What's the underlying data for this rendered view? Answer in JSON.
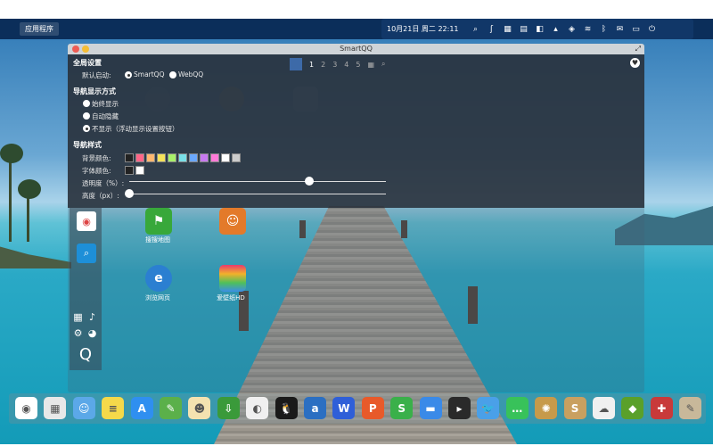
{
  "topbar": {
    "apps_button": "应用程序",
    "clock": "10月21日 周二 22:11",
    "tray_icons": [
      "search-icon",
      "python-icon",
      "calendar-icon",
      "clipboard-icon",
      "qq-panel-icon",
      "wallpaper-icon",
      "shield-icon",
      "wifi-icon",
      "bluetooth-icon",
      "mail-icon",
      "display-icon",
      "power-icon"
    ]
  },
  "window": {
    "title": "SmartQQ"
  },
  "settings": {
    "global_title": "全局设置",
    "default_launch_label": "默认启动:",
    "launch_options": [
      "SmartQQ",
      "WebQQ"
    ],
    "nav_mode_title": "导航显示方式",
    "nav_mode_options": [
      "始终显示",
      "自动隐藏",
      "不显示（浮动显示设置按钮）"
    ],
    "nav_style_title": "导航样式",
    "bg_color_label": "背景颜色:",
    "font_color_label": "字体颜色:",
    "opacity_label": "透明度（%）:",
    "height_label": "高度（px）:",
    "bg_colors": [
      "#222222",
      "#ff6688",
      "#ffb870",
      "#f5e25a",
      "#a8f06a",
      "#7ae0e8",
      "#6aa8ff",
      "#c77af0",
      "#ff7ad8",
      "#ffffff",
      "#cccccc"
    ],
    "font_colors": [
      "#222222",
      "#ffffff"
    ],
    "opacity_fraction": 0.7,
    "height_fraction": 0.0
  },
  "pager": {
    "pages": [
      "1",
      "2",
      "3",
      "4",
      "5"
    ],
    "active": "1"
  },
  "desktop_apps": [
    {
      "label": "搜搜地图",
      "icon": "flag-map-icon"
    },
    {
      "label": "",
      "icon": "people-icon"
    },
    {
      "label": "浏览网页",
      "icon": "ie-browser-icon"
    },
    {
      "label": "爱壁纸HD",
      "icon": "wallpaper-hd-icon"
    }
  ],
  "dock_icons": [
    "chrome-icon",
    "launchpad-icon",
    "finder-icon",
    "notes-icon",
    "appstore-icon",
    "evernote-icon",
    "face-icon",
    "download-icon",
    "toggle-icon",
    "qq-penguin-icon",
    "app-a-icon",
    "wps-w-icon",
    "wps-p-icon",
    "wps-s-icon",
    "window-icon",
    "terminal-icon",
    "bird-icon",
    "chat-icon",
    "compass-icon",
    "s-icon",
    "cloud-icon",
    "android-icon",
    "briefcase-icon",
    "gimp-icon"
  ],
  "colors": {
    "topbar": "#0b2e5a",
    "accent": "#1d8fd8"
  }
}
